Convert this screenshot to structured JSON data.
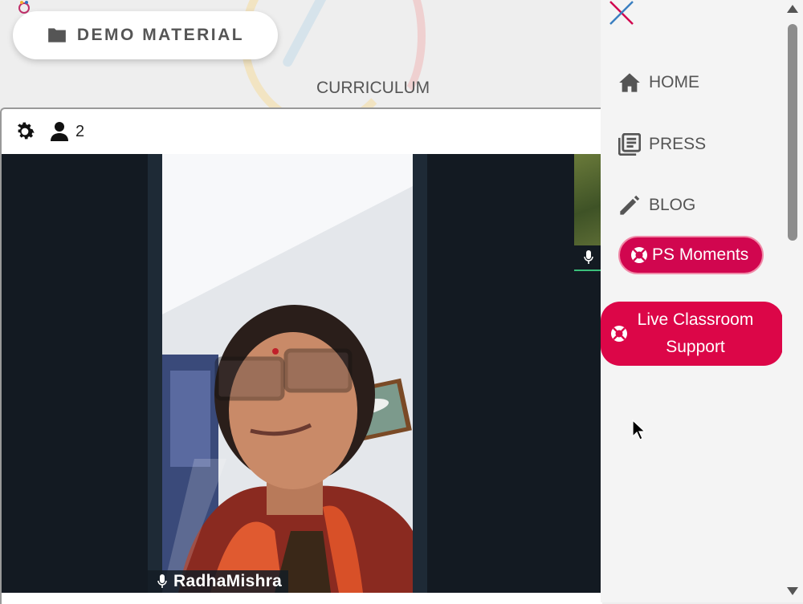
{
  "header": {
    "demo_button_label": "DEMO MATERIAL",
    "curriculum_label": "CURRICULUM"
  },
  "video": {
    "participant_count": "2",
    "participant_name": "RadhaMishra"
  },
  "sidebar": {
    "items": [
      {
        "label": "HOME",
        "icon": "home-icon"
      },
      {
        "label": "PRESS",
        "icon": "newspaper-icon"
      },
      {
        "label": "BLOG",
        "icon": "pencil-icon"
      }
    ],
    "ps_moments_label": "PS Moments",
    "live_support_label": "Live Classroom Support"
  },
  "colors": {
    "accent_pink": "#d1064f",
    "live_support_bg": "#dc0648",
    "text_gray": "#555555",
    "video_bg": "#131a22"
  }
}
